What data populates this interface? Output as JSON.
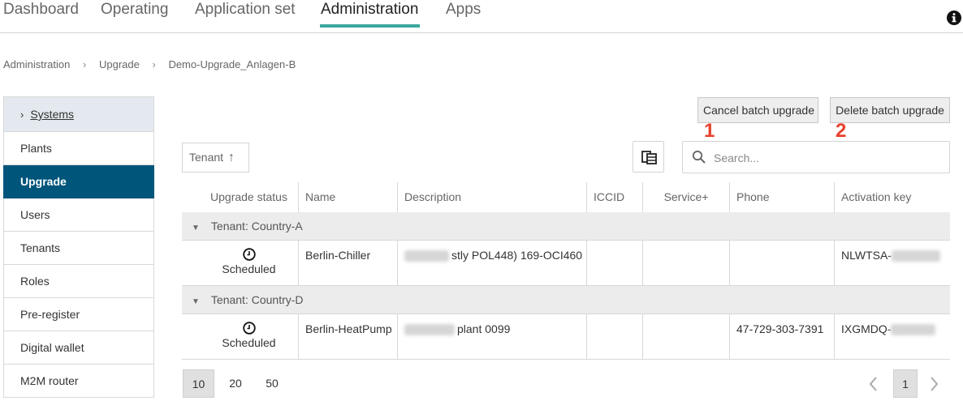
{
  "nav": {
    "tabs": [
      "Dashboard",
      "Operating",
      "Application set",
      "Administration",
      "Apps"
    ],
    "active_tab": "Administration"
  },
  "breadcrumb": [
    "Administration",
    "Upgrade",
    "Demo-Upgrade_Anlagen-B"
  ],
  "sidebar": {
    "items": [
      "Systems",
      "Plants",
      "Upgrade",
      "Users",
      "Tenants",
      "Roles",
      "Pre-register",
      "Digital wallet",
      "M2M router"
    ],
    "active": "Upgrade"
  },
  "actions": {
    "cancel_label": "Cancel batch upgrade",
    "delete_label": "Delete batch upgrade",
    "cancel_marker": "1",
    "delete_marker": "2"
  },
  "toolbar": {
    "sort_label": "Tenant",
    "search_placeholder": "Search..."
  },
  "table": {
    "columns": [
      "Upgrade status",
      "Name",
      "Description",
      "ICCID",
      "Service+",
      "Phone",
      "Activation key"
    ],
    "groups": [
      {
        "label": "Tenant: Country-A",
        "rows": [
          {
            "status": "Scheduled",
            "name": "Berlin-Chiller",
            "description": "stly POL448) 169-OCI460",
            "iccid": "",
            "service": "",
            "phone": "",
            "activation_key": "NLWTSA-"
          }
        ]
      },
      {
        "label": "Tenant: Country-D",
        "rows": [
          {
            "status": "Scheduled",
            "name": "Berlin-HeatPump",
            "description": "plant 0099",
            "iccid": "",
            "service": "",
            "phone": "47-729-303-7391",
            "activation_key": "IXGMDQ-"
          }
        ]
      }
    ]
  },
  "pagination": {
    "page_sizes": [
      "10",
      "20",
      "50"
    ],
    "selected_size": "10",
    "current_page": "1"
  },
  "colors": {
    "accent": "#3aa89c",
    "sidebar_active": "#00557b",
    "annotation": "#e8412c"
  }
}
